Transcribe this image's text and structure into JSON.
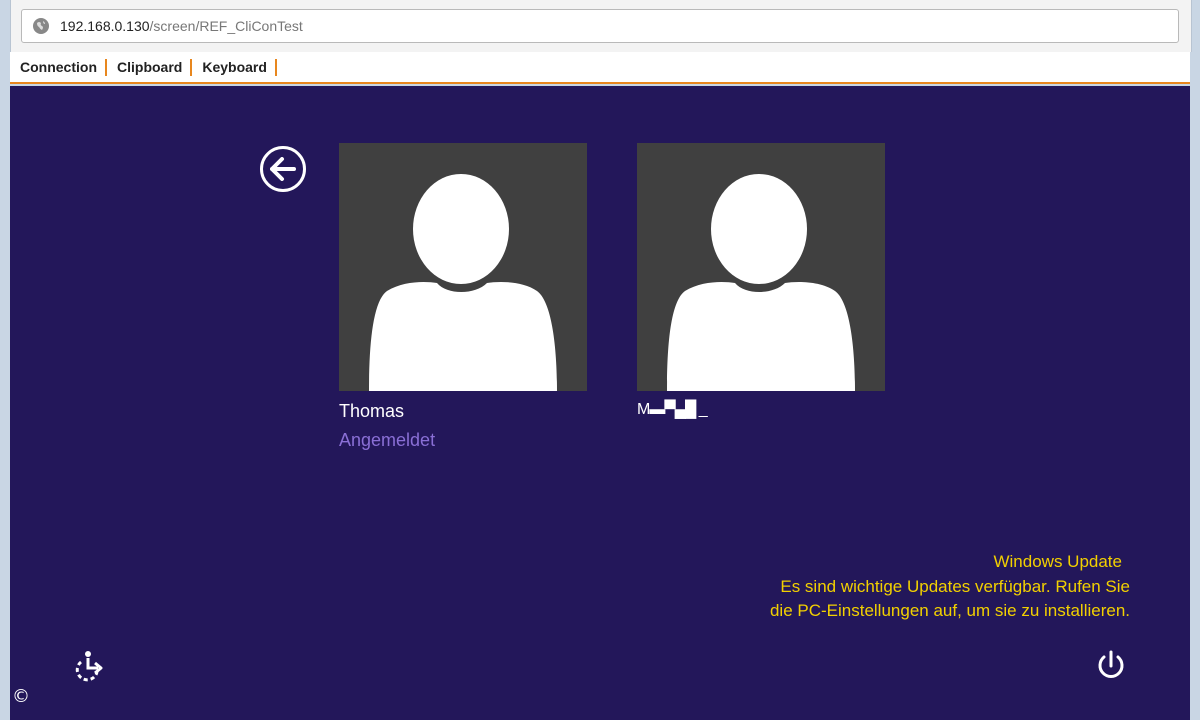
{
  "browser": {
    "url_host": "192.168.0.130",
    "url_path": "/screen/REF_CliConTest"
  },
  "menu": {
    "items": [
      {
        "label": "Connection"
      },
      {
        "label": "Clipboard"
      },
      {
        "label": "Keyboard"
      }
    ]
  },
  "login": {
    "users": [
      {
        "name": "Thomas",
        "status": "Angemeldet"
      },
      {
        "name": "M▬▀▄█ _"
      }
    ]
  },
  "notification": {
    "title": "Windows Update",
    "line1": "Es sind wichtige Updates verfügbar. Rufen Sie",
    "line2": "die PC-Einstellungen auf, um sie zu installieren."
  },
  "icons": {
    "back": "arrow-left-circle-icon",
    "ease_of_access": "ease-of-access-icon",
    "power": "power-icon",
    "site_info": "globe-icon"
  },
  "colors": {
    "screen_background": "#23175a",
    "tile_background": "#404040",
    "accent_orange": "#e8871e",
    "notification_text": "#f2d000",
    "signed_in_text": "#8a6fd6"
  },
  "watermark": "©"
}
